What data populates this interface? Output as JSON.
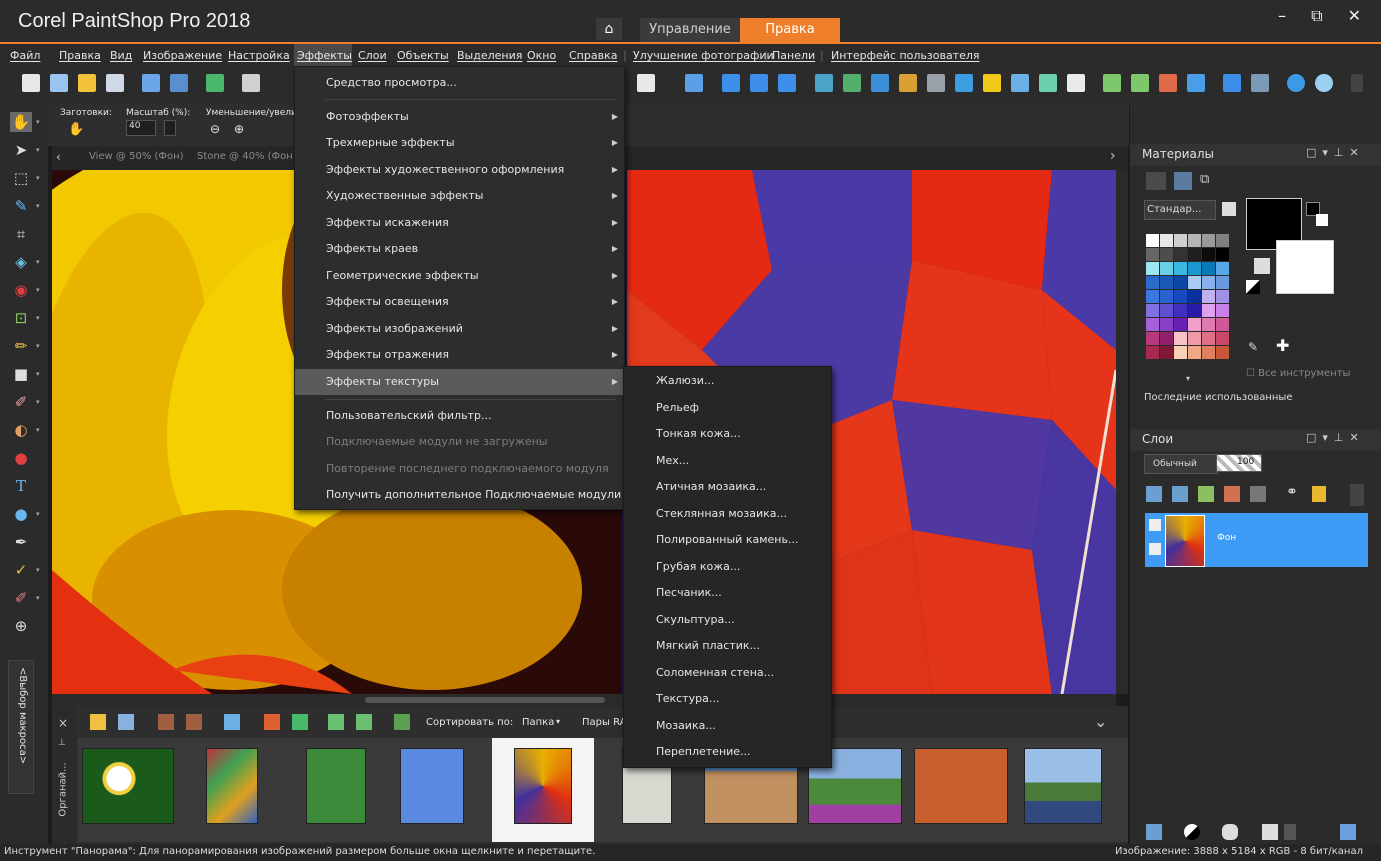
{
  "app": {
    "title": "Corel PaintShop Pro 2018",
    "tabs": [
      "Управление",
      "Правка"
    ],
    "window_controls": "– ⧉ ✕"
  },
  "menubar": [
    "Файл",
    "Правка",
    "Вид",
    "Изображение",
    "Настройка",
    "Эффекты",
    "Слои",
    "Объекты",
    "Выделения",
    "Окно",
    "Справка",
    "Улучшение фотографии",
    "Панели",
    "Интерфейс пользователя"
  ],
  "options": {
    "presets_label": "Заготовки:",
    "scale_label": "Масштаб (%):",
    "scale_value": "40",
    "zoom_label": "Уменьшение/увеличе"
  },
  "doc_tabs": [
    "View @  50% (Фон)",
    "Stone @  40% (Фон)"
  ],
  "effects_menu": {
    "items": [
      {
        "label": "Средство просмотра...",
        "arrow": false,
        "disabled": false
      },
      {
        "label": "Фотоэффекты",
        "arrow": true,
        "disabled": false
      },
      {
        "label": "Трехмерные эффекты",
        "arrow": true,
        "disabled": false
      },
      {
        "label": "Эффекты художественного оформления",
        "arrow": true,
        "disabled": false
      },
      {
        "label": "Художественные эффекты",
        "arrow": true,
        "disabled": false
      },
      {
        "label": "Эффекты искажения",
        "arrow": true,
        "disabled": false
      },
      {
        "label": "Эффекты краев",
        "arrow": true,
        "disabled": false
      },
      {
        "label": "Геометрические эффекты",
        "arrow": true,
        "disabled": false
      },
      {
        "label": "Эффекты освещения",
        "arrow": true,
        "disabled": false
      },
      {
        "label": "Эффекты изображений",
        "arrow": true,
        "disabled": false
      },
      {
        "label": "Эффекты отражения",
        "arrow": true,
        "disabled": false
      },
      {
        "label": "Эффекты текстуры",
        "arrow": true,
        "disabled": false,
        "highlighted": true
      },
      {
        "label": "Пользовательский фильтр...",
        "arrow": false,
        "disabled": false
      },
      {
        "label": "Подключаемые модули не загружены",
        "arrow": false,
        "disabled": true
      },
      {
        "label": "Повторение последнего подключаемого модуля",
        "arrow": false,
        "disabled": true
      },
      {
        "label": "Получить дополнительное Подключаемые модули",
        "arrow": false,
        "disabled": false
      }
    ]
  },
  "texture_submenu": [
    "Жалюзи...",
    "Рельеф",
    "Тонкая кожа...",
    "Мех...",
    "Атичная мозаика...",
    "Стеклянная мозаика...",
    "Полированный камень...",
    "Грубая кожа...",
    "Песчаник...",
    "Скульптура...",
    "Мягкий пластик...",
    "Соломенная стена...",
    "Текстура...",
    "Мозаика...",
    "Переплетение..."
  ],
  "organizer": {
    "sort_label": "Сортировать по:",
    "sort_value": "Папка",
    "pairs_label": "Пары RA",
    "side_label": "Органай...",
    "macro_label": "<Выбор макроса>"
  },
  "materials": {
    "title": "Материалы",
    "style_value": "Стандар...",
    "all_tools": "Все инструменты",
    "recent": "Последние использованные"
  },
  "layers": {
    "title": "Слои",
    "blend_mode": "Обычный",
    "opacity": "100",
    "layer_name": "Фон"
  },
  "status": {
    "left": "Инструмент \"Панорама\": Для панорамирования изображений размером больше окна щелкните и перетащите.",
    "right": "Изображение:  3888 x 5184 x RGB - 8 бит/канал"
  },
  "colors": {
    "accent": "#ef7f2a",
    "selection": "#3e9bf6"
  }
}
